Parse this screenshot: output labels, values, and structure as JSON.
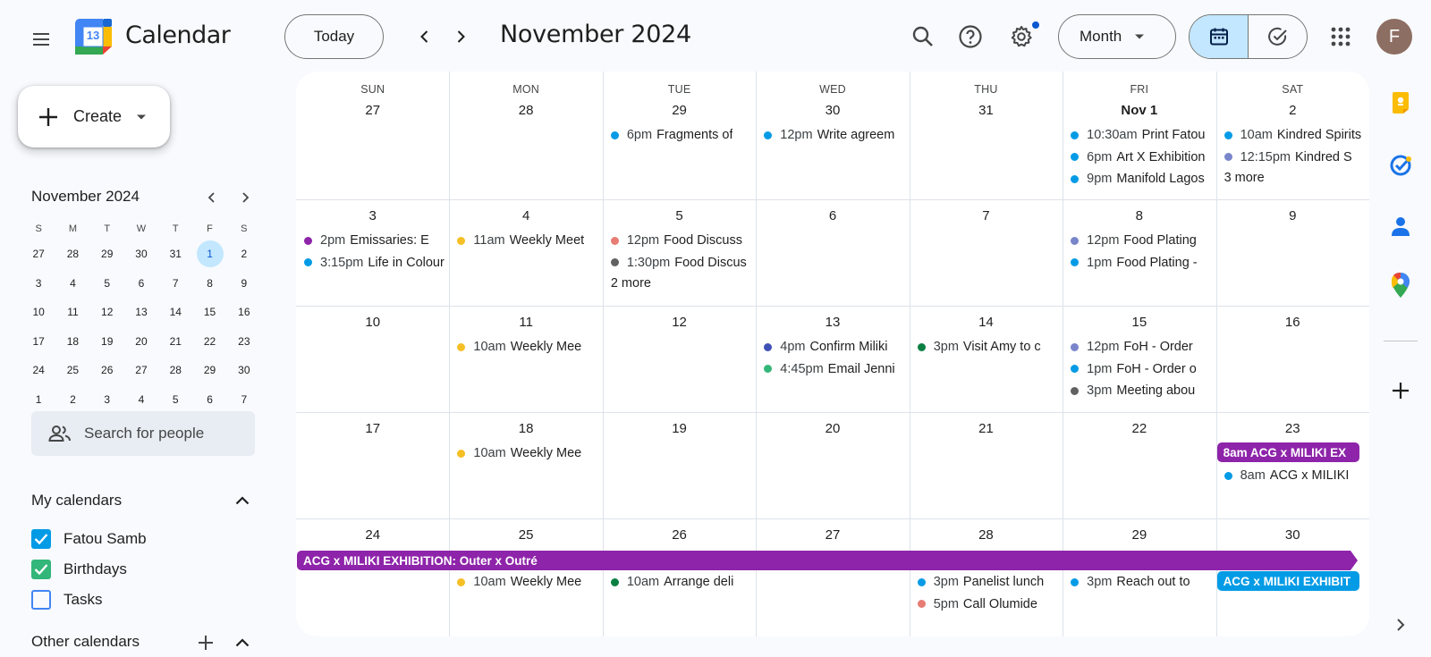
{
  "app": {
    "title": "Calendar",
    "logo_day": "13"
  },
  "header": {
    "today_label": "Today",
    "month_title": "November 2024",
    "view_label": "Month",
    "avatar_initial": "F"
  },
  "sidebar": {
    "create_label": "Create",
    "mini_title": "November 2024",
    "mini_dow": [
      "S",
      "M",
      "T",
      "W",
      "T",
      "F",
      "S"
    ],
    "mini_weeks": [
      [
        "27",
        "28",
        "29",
        "30",
        "31",
        "1",
        "2"
      ],
      [
        "3",
        "4",
        "5",
        "6",
        "7",
        "8",
        "9"
      ],
      [
        "10",
        "11",
        "12",
        "13",
        "14",
        "15",
        "16"
      ],
      [
        "17",
        "18",
        "19",
        "20",
        "21",
        "22",
        "23"
      ],
      [
        "24",
        "25",
        "26",
        "27",
        "28",
        "29",
        "30"
      ],
      [
        "1",
        "2",
        "3",
        "4",
        "5",
        "6",
        "7"
      ]
    ],
    "mini_selected": "1",
    "people_placeholder": "Search for people",
    "my_calendars_title": "My calendars",
    "my_calendars": [
      {
        "label": "Fatou Samb",
        "checked": true,
        "color": "#039be5"
      },
      {
        "label": "Birthdays",
        "checked": true,
        "color": "#33b679"
      },
      {
        "label": "Tasks",
        "checked": false,
        "color": "#4285f4"
      }
    ],
    "other_calendars_title": "Other calendars"
  },
  "grid": {
    "dow": [
      "SUN",
      "MON",
      "TUE",
      "WED",
      "THU",
      "FRI",
      "SAT"
    ],
    "weeks": [
      [
        {
          "num": "27",
          "events": []
        },
        {
          "num": "28",
          "events": []
        },
        {
          "num": "29",
          "events": [
            {
              "time": "6pm",
              "title": "Fragments of",
              "color": "#039be5"
            }
          ]
        },
        {
          "num": "30",
          "events": [
            {
              "time": "12pm",
              "title": "Write agreem",
              "color": "#039be5"
            }
          ]
        },
        {
          "num": "31",
          "events": []
        },
        {
          "num": "Nov 1",
          "bold": true,
          "events": [
            {
              "time": "10:30am",
              "title": "Print Fatou",
              "color": "#039be5"
            },
            {
              "time": "6pm",
              "title": "Art X Exhibition",
              "color": "#039be5"
            },
            {
              "time": "9pm",
              "title": "Manifold Lagos",
              "color": "#039be5"
            }
          ]
        },
        {
          "num": "2",
          "events": [
            {
              "time": "10am",
              "title": "Kindred Spirits",
              "color": "#039be5"
            },
            {
              "time": "12:15pm",
              "title": "Kindred S",
              "color": "#7986cb"
            }
          ],
          "more": "3 more"
        }
      ],
      [
        {
          "num": "3",
          "events": [
            {
              "time": "2pm",
              "title": "Emissaries: E",
              "color": "#8e24aa"
            },
            {
              "time": "3:15pm",
              "title": "Life in Colour",
              "color": "#039be5"
            }
          ]
        },
        {
          "num": "4",
          "events": [
            {
              "time": "11am",
              "title": "Weekly Meet",
              "color": "#f6bf26"
            }
          ]
        },
        {
          "num": "5",
          "events": [
            {
              "time": "12pm",
              "title": "Food Discuss",
              "color": "#e67c73"
            },
            {
              "time": "1:30pm",
              "title": "Food Discus",
              "color": "#616161"
            }
          ],
          "more": "2 more"
        },
        {
          "num": "6",
          "events": []
        },
        {
          "num": "7",
          "events": []
        },
        {
          "num": "8",
          "events": [
            {
              "time": "12pm",
              "title": "Food Plating",
              "color": "#7986cb"
            },
            {
              "time": "1pm",
              "title": "Food Plating -",
              "color": "#039be5"
            }
          ]
        },
        {
          "num": "9",
          "events": []
        }
      ],
      [
        {
          "num": "10",
          "events": []
        },
        {
          "num": "11",
          "events": [
            {
              "time": "10am",
              "title": "Weekly Mee",
              "color": "#f6bf26"
            }
          ]
        },
        {
          "num": "12",
          "events": []
        },
        {
          "num": "13",
          "events": [
            {
              "time": "4pm",
              "title": "Confirm Miliki",
              "color": "#3f51b5"
            },
            {
              "time": "4:45pm",
              "title": "Email Jenni",
              "color": "#33b679"
            }
          ]
        },
        {
          "num": "14",
          "events": [
            {
              "time": "3pm",
              "title": "Visit Amy to c",
              "color": "#0b8043"
            }
          ]
        },
        {
          "num": "15",
          "events": [
            {
              "time": "12pm",
              "title": "FoH - Order",
              "color": "#7986cb"
            },
            {
              "time": "1pm",
              "title": "FoH - Order o",
              "color": "#039be5"
            },
            {
              "time": "3pm",
              "title": "Meeting abou",
              "color": "#616161"
            }
          ]
        },
        {
          "num": "16",
          "events": []
        }
      ],
      [
        {
          "num": "17",
          "events": []
        },
        {
          "num": "18",
          "events": [
            {
              "time": "10am",
              "title": "Weekly Mee",
              "color": "#f6bf26"
            }
          ]
        },
        {
          "num": "19",
          "events": []
        },
        {
          "num": "20",
          "events": []
        },
        {
          "num": "21",
          "events": []
        },
        {
          "num": "22",
          "events": []
        },
        {
          "num": "23",
          "bar": {
            "text": "8am ACG x MILIKI EX",
            "color": "#8e24aa"
          },
          "events": [
            {
              "time": "8am",
              "title": "ACG x MILIKI",
              "color": "#039be5"
            }
          ]
        }
      ],
      [
        {
          "num": "24",
          "events": []
        },
        {
          "num": "25",
          "events": [
            {
              "time": "10am",
              "title": "Weekly Mee",
              "color": "#f6bf26"
            }
          ]
        },
        {
          "num": "26",
          "events": [
            {
              "time": "10am",
              "title": "Arrange deli",
              "color": "#0b8043"
            }
          ]
        },
        {
          "num": "27",
          "events": []
        },
        {
          "num": "28",
          "events": [
            {
              "time": "3pm",
              "title": "Panelist lunch",
              "color": "#039be5"
            },
            {
              "time": "5pm",
              "title": "Call Olumide",
              "color": "#e67c73"
            }
          ]
        },
        {
          "num": "29",
          "events": [
            {
              "time": "3pm",
              "title": "Reach out to",
              "color": "#039be5"
            }
          ]
        },
        {
          "num": "30",
          "bar": {
            "text": "ACG x MILIKI EXHIBIT",
            "color": "#039be5"
          },
          "events": []
        }
      ]
    ],
    "span_bar": {
      "text": "ACG x MILIKI EXHIBITION: Outer x Outré",
      "color": "#8e24aa"
    }
  },
  "rail": {
    "icons": [
      "keep-icon",
      "tasks-icon",
      "contacts-icon",
      "maps-icon",
      "add-icon",
      "expand-icon"
    ]
  }
}
